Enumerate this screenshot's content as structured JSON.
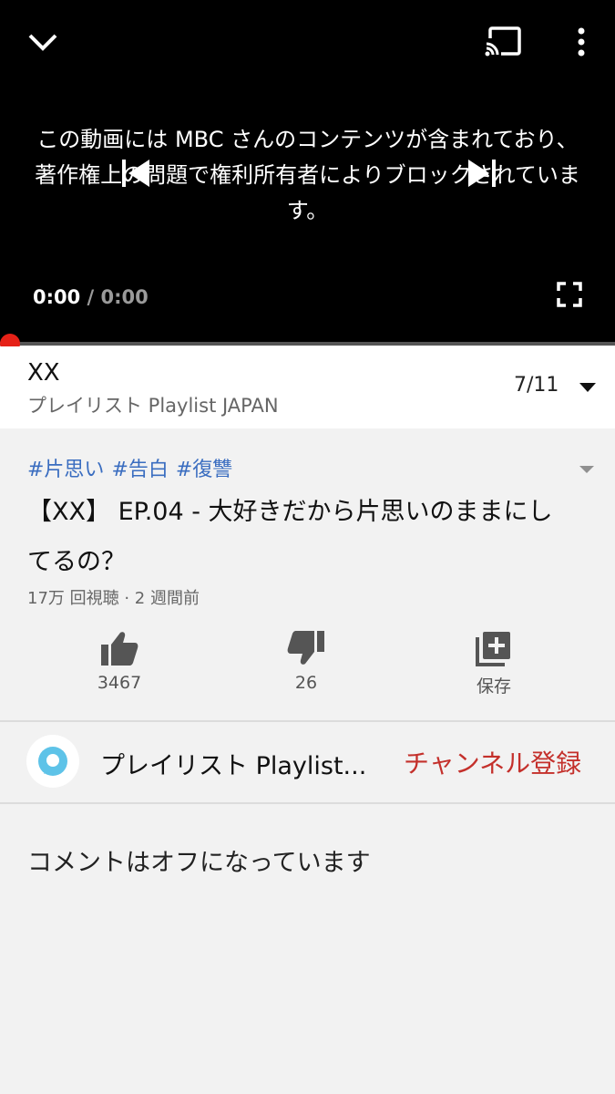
{
  "player": {
    "blocked_message": "この動画には MBC さんのコンテンツが含まれており、著作権上の問題で権利所有者によりブロックされています。",
    "current_time": "0:00",
    "duration": "/ 0:00",
    "progress": 0
  },
  "playlist": {
    "title": "XX",
    "channel": "プレイリスト Playlist JAPAN",
    "position": "7/11"
  },
  "video": {
    "hashtags": [
      "#片思い",
      "#告白",
      "#復讐"
    ],
    "title": "【XX】 EP.04 - 大好きだから片思いのままにしてるの？",
    "meta": "17万 回視聴 · 2 週間前"
  },
  "actions": {
    "like_count": "3467",
    "dislike_count": "26",
    "save_label": "保存"
  },
  "channel": {
    "name": "プレイリスト Playlist...",
    "subscribe_label": "チャンネル登録"
  },
  "comments": {
    "status": "コメントはオフになっています"
  },
  "colors": {
    "progress": "#e62117",
    "subscribe": "#c4302b",
    "hashtag": "#3a6dc0"
  }
}
